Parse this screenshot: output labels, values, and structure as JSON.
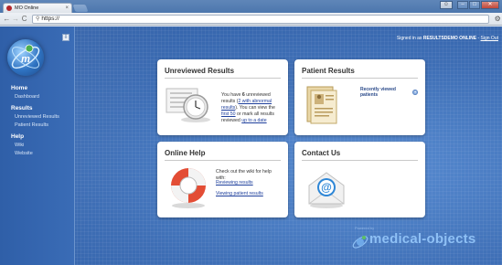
{
  "browser": {
    "tab_title": "MO Online",
    "tab_close": "×",
    "url": "https://",
    "window_buttons": {
      "user": "☺",
      "minimize": "–",
      "maximize": "□",
      "close": "✕"
    }
  },
  "header": {
    "signed_in_prefix": "Signed in as",
    "user": "RESULTSDEMO ONLINE",
    "separator": "-",
    "sign_out": "Sign Out"
  },
  "sidebar": {
    "collapse_label": "⇩",
    "sections": [
      {
        "title": "Home",
        "items": [
          "Dashboard"
        ]
      },
      {
        "title": "Results",
        "items": [
          "Unreviewed Results",
          "Patient Results"
        ]
      },
      {
        "title": "Help",
        "items": [
          "Wiki",
          "Website"
        ]
      }
    ]
  },
  "cards": {
    "unreviewed": {
      "title": "Unreviewed Results",
      "text_1": "You have",
      "count": "6",
      "text_2": "unreviewed results (",
      "abnormal_link": "2 with abnormal results",
      "text_3": "). You can view the",
      "first_link": "first 50",
      "text_4": "or mark all results reviewed",
      "uptodate_link": "up to a date"
    },
    "patient": {
      "title": "Patient Results",
      "recent_label": "Recently viewed patients",
      "recent_icon": "+"
    },
    "help": {
      "title": "Online Help",
      "text": "Check out the wiki for help with:",
      "link_1": "Reviewing results",
      "link_2": "Viewing patient results"
    },
    "contact": {
      "title": "Contact Us"
    }
  },
  "footer": {
    "powered_by": "Powered by",
    "brand": "medical-objects"
  },
  "colors": {
    "page_blue": "#3e6eb5",
    "link": "#1e3f9c",
    "brand": "#8ec0f5"
  }
}
